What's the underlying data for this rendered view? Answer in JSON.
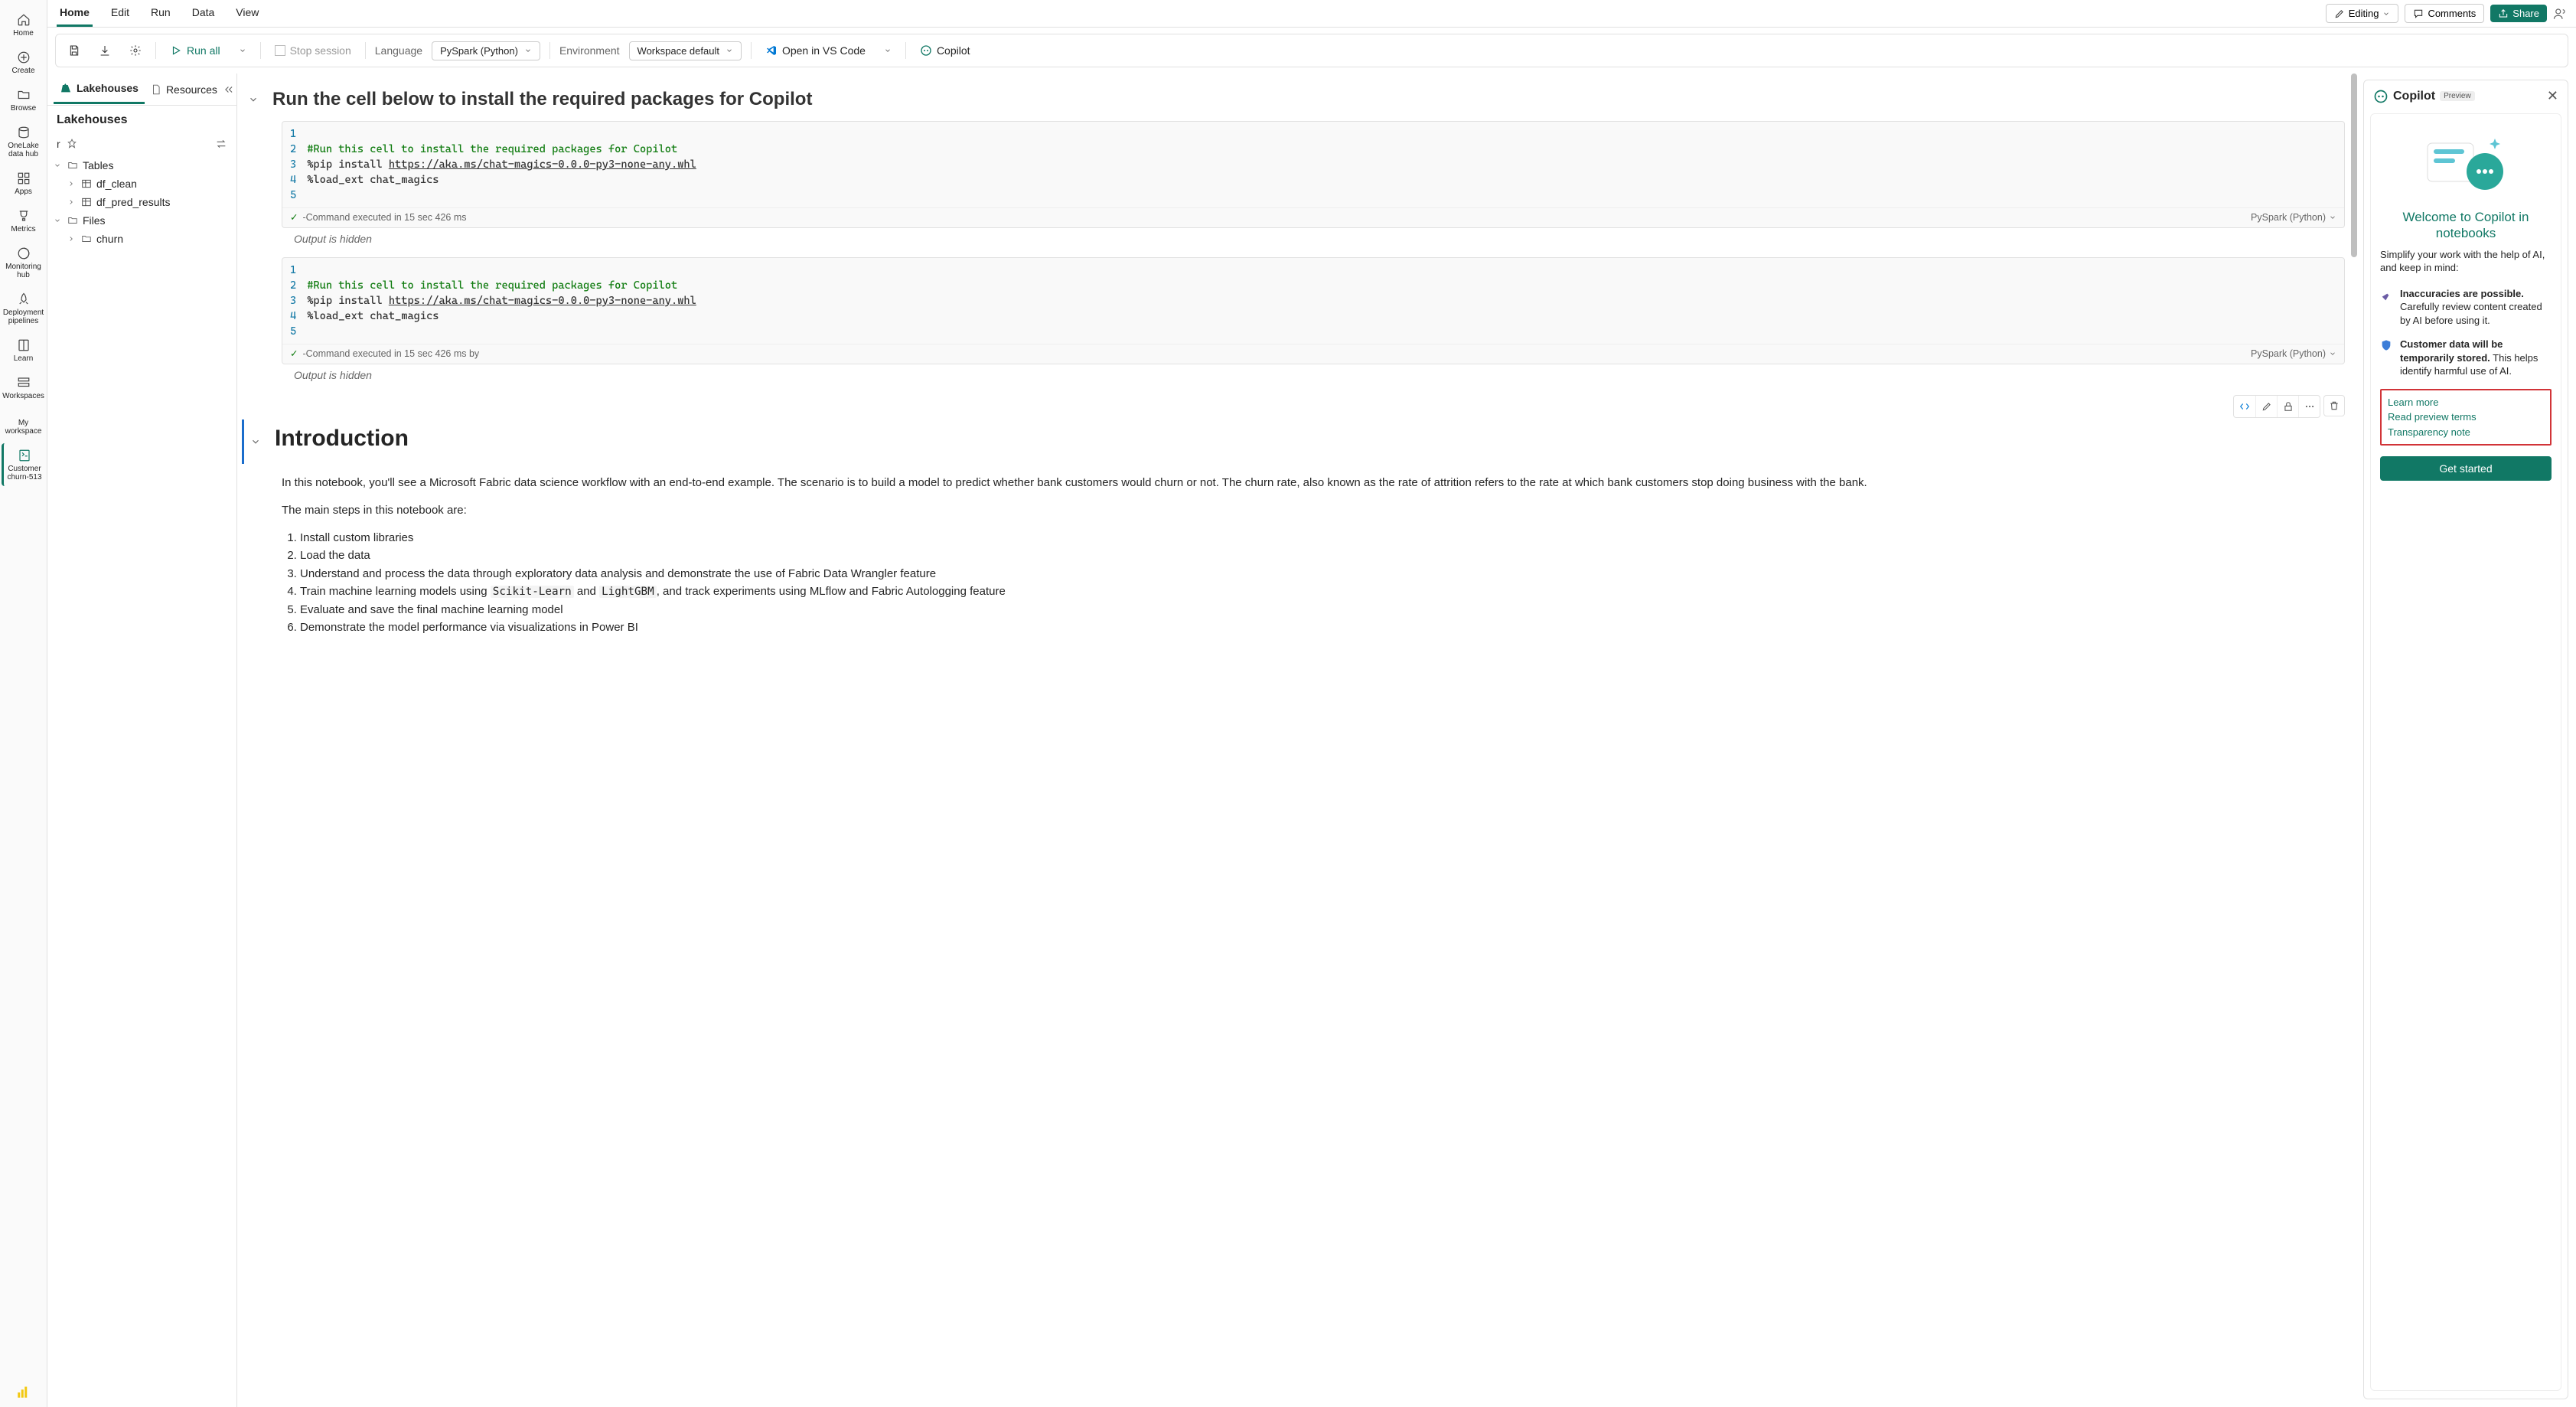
{
  "rail": {
    "items": [
      {
        "label": "Home"
      },
      {
        "label": "Create"
      },
      {
        "label": "Browse"
      },
      {
        "label": "OneLake data hub"
      },
      {
        "label": "Apps"
      },
      {
        "label": "Metrics"
      },
      {
        "label": "Monitoring hub"
      },
      {
        "label": "Deployment pipelines"
      },
      {
        "label": "Learn"
      },
      {
        "label": "Workspaces"
      },
      {
        "label": "My workspace"
      },
      {
        "label": "Customer churn-513"
      }
    ]
  },
  "ribbon": {
    "tabs": [
      "Home",
      "Edit",
      "Run",
      "Data",
      "View"
    ],
    "editing": "Editing",
    "comments": "Comments",
    "share": "Share"
  },
  "toolbar": {
    "runAll": "Run all",
    "stop": "Stop session",
    "languageLabel": "Language",
    "languageValue": "PySpark (Python)",
    "envLabel": "Environment",
    "envValue": "Workspace default",
    "vscode": "Open in VS Code",
    "copilot": "Copilot"
  },
  "explorer": {
    "tabs": {
      "lakehouses": "Lakehouses",
      "resources": "Resources"
    },
    "title": "Lakehouses",
    "searchValue": "r",
    "tree": {
      "tables": "Tables",
      "dfClean": "df_clean",
      "dfPred": "df_pred_results",
      "files": "Files",
      "churn": "churn"
    }
  },
  "notebook": {
    "heading1": "Run the cell below to install the required packages for Copilot",
    "code": {
      "lineNums": [
        "1",
        "2",
        "3",
        "4",
        "5"
      ],
      "comment": "#Run this cell to install the required packages for Copilot",
      "pip": "%pip install ",
      "url": "https://aka.ms/chat-magics-0.0.0-py3-none-any.whl",
      "loadext": "%load_ext chat_magics"
    },
    "status1": "-Command executed in 15 sec 426 ms",
    "status2": "-Command executed in 15 sec 426 ms by",
    "langTag": "PySpark (Python)",
    "outputHidden": "Output is hidden",
    "intro": {
      "title": "Introduction",
      "p1a": "In this notebook, you'll see a Microsoft Fabric data science workflow with an end-to-end example. The scenario is to build a model to predict whether bank customers would churn or not. The churn rate, also known as the rate of attrition refers to the rate at which bank customers stop doing business with the bank.",
      "p2": "The main steps in this notebook are:",
      "steps": [
        "Install custom libraries",
        "Load the data",
        "Understand and process the data through exploratory data analysis and demonstrate the use of Fabric Data Wrangler feature",
        "Train machine learning models using ",
        " and ",
        ", and track experiments using MLflow and Fabric Autologging feature",
        "Evaluate and save the final machine learning model",
        "Demonstrate the model performance via visualizations in Power BI"
      ],
      "codeScikit": "Scikit-Learn",
      "codeLGBM": "LightGBM"
    }
  },
  "copilot": {
    "title": "Copilot",
    "preview": "Preview",
    "welcome": "Welcome to Copilot in notebooks",
    "sub": "Simplify your work with the help of AI, and keep in mind:",
    "n1t": "Inaccuracies are possible.",
    "n1b": "Carefully review content created by AI before using it.",
    "n2t": "Customer data will be temporarily stored.",
    "n2b": "This helps identify harmful use of AI.",
    "link1": "Learn more",
    "link2": "Read preview terms",
    "link3": "Transparency note",
    "cta": "Get started"
  }
}
